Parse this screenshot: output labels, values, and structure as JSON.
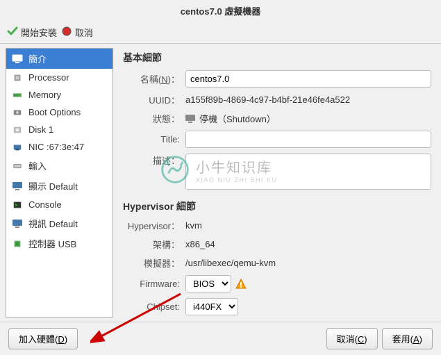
{
  "title": "centos7.0 虛擬機器",
  "toolbar": {
    "start_install": "開始安裝",
    "cancel": "取消"
  },
  "sidebar": {
    "items": [
      {
        "label": "簡介"
      },
      {
        "label": "Processor"
      },
      {
        "label": "Memory"
      },
      {
        "label": "Boot Options"
      },
      {
        "label": "Disk 1"
      },
      {
        "label": "NIC :67:3e:47"
      },
      {
        "label": "輸入"
      },
      {
        "label": "顯示 Default"
      },
      {
        "label": "Console"
      },
      {
        "label": "視訊 Default"
      },
      {
        "label": "控制器 USB"
      }
    ]
  },
  "basic": {
    "title": "基本細節",
    "name_label_pre": "名稱(",
    "name_label_key": "N",
    "name_label_post": ")：",
    "name_value": "centos7.0",
    "uuid_label": "UUID：",
    "uuid_value": "a155f89b-4869-4c97-b4bf-21e46fe4a522",
    "state_label": "狀態：",
    "state_value": "停機（Shutdown）",
    "title_label": "Title:",
    "title_value": "",
    "desc_label": "描述：",
    "desc_value": ""
  },
  "hypervisor": {
    "title": "Hypervisor 細節",
    "hv_label": "Hypervisor：",
    "hv_value": "kvm",
    "arch_label": "架構：",
    "arch_value": "x86_64",
    "emu_label": "模擬器：",
    "emu_value": "/usr/libexec/qemu-kvm",
    "fw_label": "Firmware:",
    "fw_value": "BIOS",
    "chipset_label": "Chipset:",
    "chipset_value": "i440FX"
  },
  "footer": {
    "add_hw_pre": "加入硬體(",
    "add_hw_key": "D",
    "add_hw_post": ")",
    "cancel_pre": "取消(",
    "cancel_key": "C",
    "cancel_post": ")",
    "apply_pre": "套用(",
    "apply_key": "A",
    "apply_post": ")"
  },
  "watermark": {
    "cn": "小牛知识库",
    "py": "XIAO NIU ZHI SHI KU"
  }
}
